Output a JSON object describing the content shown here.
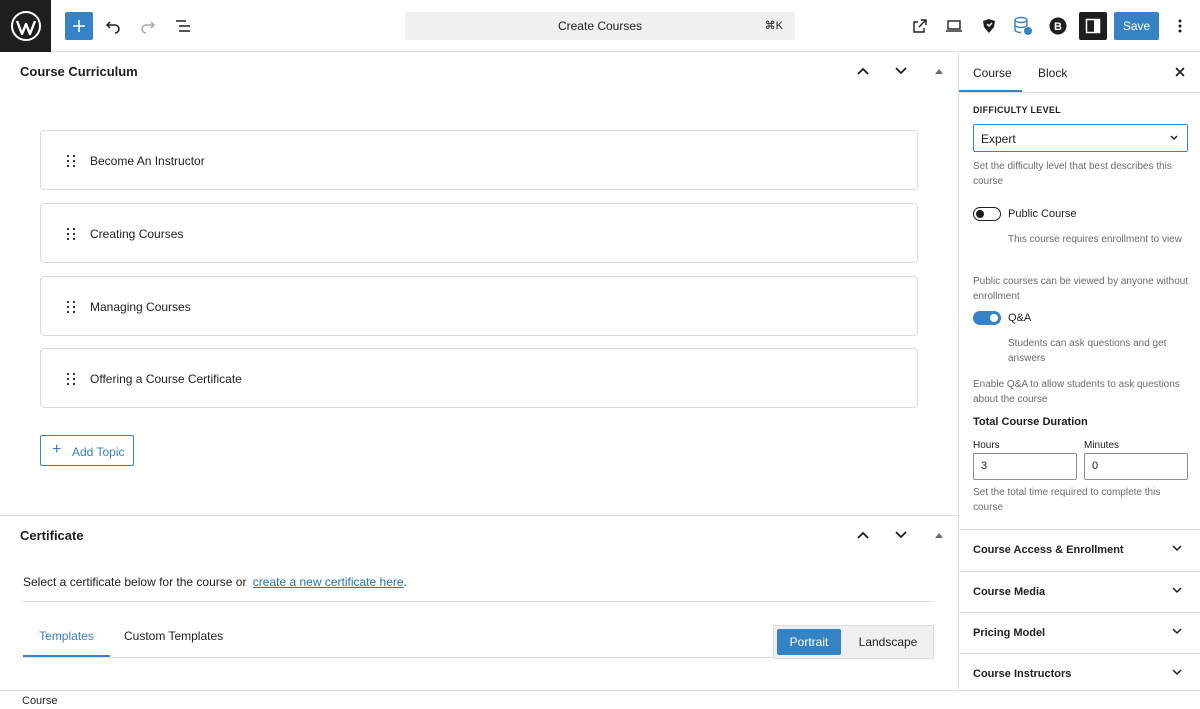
{
  "toolbar": {
    "document_title": "Create Courses",
    "shortcut": "⌘K",
    "save_label": "Save",
    "icons": [
      "wordpress-logo",
      "plus-icon",
      "undo-icon",
      "redo-icon",
      "list-view-icon",
      "external-link-icon",
      "preview-device-icon",
      "shield-icon",
      "database-icon",
      "b-icon",
      "sidebar-toggle-icon",
      "more-icon"
    ],
    "accent": "#3582c4"
  },
  "curriculum": {
    "title": "Course Curriculum",
    "topics": [
      "Become An Instructor",
      "Creating Courses",
      "Managing Courses",
      "Offering a Course Certificate"
    ],
    "add_topic_label": "Add Topic"
  },
  "certificate": {
    "title": "Certificate",
    "description": "Select a certificate below for the course or",
    "link_text": "create a new certificate here",
    "period": ".",
    "tabs": [
      "Templates",
      "Custom Templates"
    ],
    "orientation_options": [
      "Portrait",
      "Landscape"
    ],
    "orientation_selected": "Portrait"
  },
  "sidebar": {
    "tabs": [
      "Course",
      "Block"
    ],
    "active_tab": "Course",
    "difficulty_label": "DIFFICULTY LEVEL",
    "difficulty_value": "Expert",
    "difficulty_help": "Set the difficulty level that best describes this course",
    "public_course_label": "Public Course",
    "public_course_on": false,
    "public_course_note": "This course requires enrollment to view",
    "public_course_help": "Public courses can be viewed by anyone without enrollment",
    "qa_label": "Q&A",
    "qa_on": true,
    "qa_note": "Students can ask questions and get answers",
    "qa_help": "Enable Q&A to allow students to ask questions about the course",
    "duration_title": "Total Course Duration",
    "hours_label": "Hours",
    "hours_value": "3",
    "minutes_label": "Minutes",
    "minutes_value": "0",
    "duration_help": "Set the total time required to complete this course",
    "sections": [
      "Course Access & Enrollment",
      "Course Media",
      "Pricing Model",
      "Course Instructors"
    ]
  },
  "footer": {
    "breadcrumb": "Course"
  }
}
